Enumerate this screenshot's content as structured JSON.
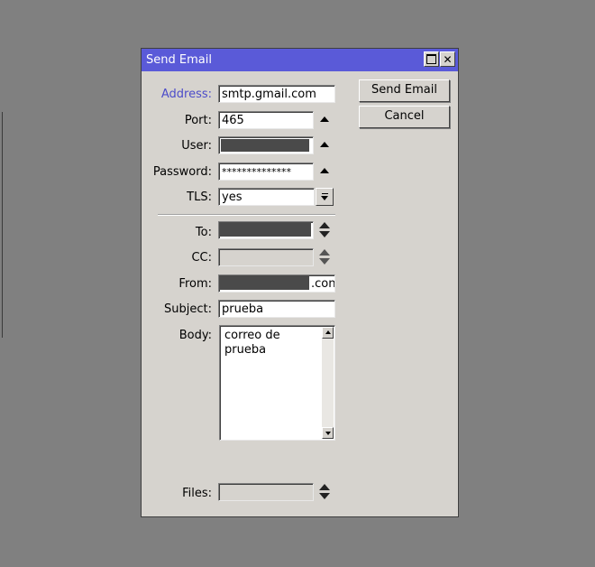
{
  "window": {
    "title": "Send Email"
  },
  "form": {
    "address": {
      "label": "Address:",
      "value": "smtp.gmail.com"
    },
    "port": {
      "label": "Port:",
      "value": "465"
    },
    "user": {
      "label": "User:",
      "value": ""
    },
    "password": {
      "label": "Password:",
      "value": "**************"
    },
    "tls": {
      "label": "TLS:",
      "value": "yes"
    },
    "to": {
      "label": "To:",
      "value": ""
    },
    "cc": {
      "label": "CC:",
      "value": ""
    },
    "from": {
      "label": "From:",
      "value": ".con"
    },
    "subject": {
      "label": "Subject:",
      "value": "prueba"
    },
    "body": {
      "label": "Body:",
      "value": "correo de\nprueba"
    },
    "files": {
      "label": "Files:",
      "value": ""
    }
  },
  "buttons": {
    "send": "Send Email",
    "cancel": "Cancel"
  },
  "colors": {
    "titlebar": "#5a5ad8",
    "dialog": "#d6d3ce",
    "accent_label": "#4c4cc9",
    "desktop": "#808080"
  }
}
